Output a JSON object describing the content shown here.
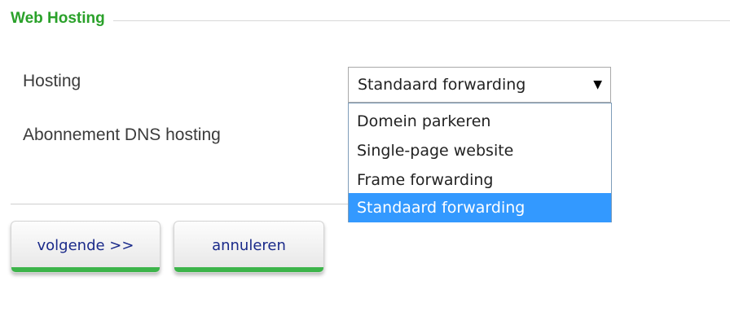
{
  "section": {
    "title": "Web Hosting"
  },
  "form": {
    "hosting_label": "Hosting",
    "dns_label": "Abonnement DNS hosting",
    "hosting_select": {
      "selected": "Standaard forwarding",
      "options": [
        "Domein parkeren",
        "Single-page website",
        "Frame forwarding",
        "Standaard forwarding"
      ],
      "highlighted_index": 3
    }
  },
  "buttons": {
    "next_label": "volgende >>",
    "cancel_label": "annuleren"
  },
  "icons": {
    "select_arrow": "▼"
  },
  "colors": {
    "title_green": "#2aa12a",
    "button_bar_green": "#3cb44a",
    "option_highlight": "#3399ff",
    "button_text": "#1a2a8a"
  }
}
